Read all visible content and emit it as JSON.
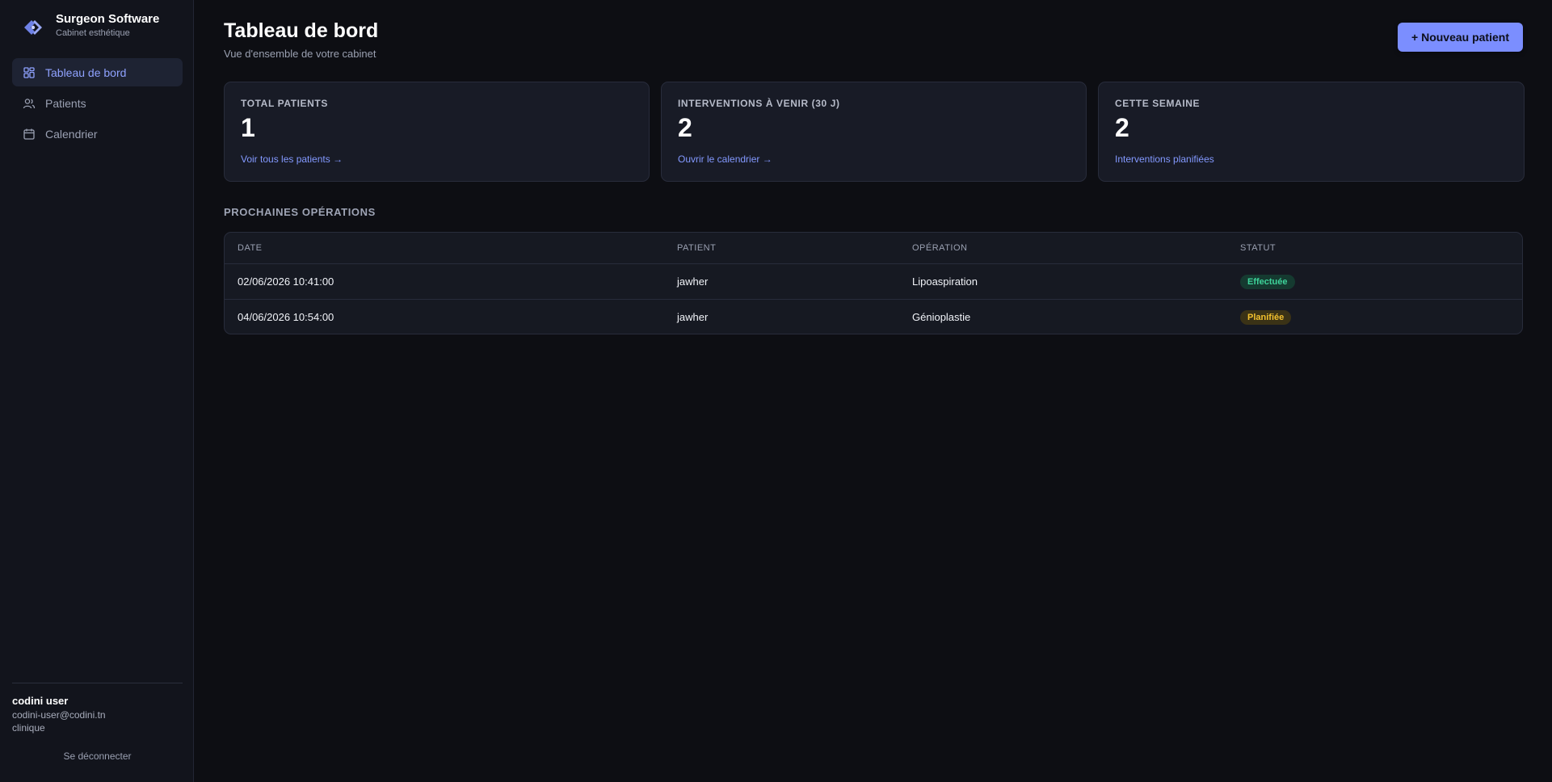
{
  "brand": {
    "name": "Surgeon Software",
    "subtitle": "Cabinet esthétique"
  },
  "sidebar": {
    "items": [
      {
        "label": "Tableau de bord",
        "icon": "dashboard-icon",
        "active": true
      },
      {
        "label": "Patients",
        "icon": "users-icon",
        "active": false
      },
      {
        "label": "Calendrier",
        "icon": "calendar-icon",
        "active": false
      }
    ]
  },
  "user": {
    "name": "codini user",
    "email": "codini-user@codini.tn",
    "role": "clinique",
    "logout_label": "Se déconnecter"
  },
  "header": {
    "title": "Tableau de bord",
    "subtitle": "Vue d'ensemble de votre cabinet",
    "new_patient_label": "+ Nouveau patient"
  },
  "stats": [
    {
      "label": "Total patients",
      "value": "1",
      "link": "Voir tous les patients →"
    },
    {
      "label": "Interventions à venir (30 j)",
      "value": "2",
      "link": "Ouvrir le calendrier →"
    },
    {
      "label": "Cette semaine",
      "value": "2",
      "link": "Interventions planifiées"
    }
  ],
  "operations": {
    "title": "Prochaines opérations",
    "columns": [
      "Date",
      "Patient",
      "Opération",
      "Statut"
    ],
    "rows": [
      {
        "date": "02/06/2026 10:41:00",
        "patient": "jawher",
        "operation": "Lipoaspiration",
        "status": "Effectuée"
      },
      {
        "date": "04/06/2026 10:54:00",
        "patient": "jawher",
        "operation": "Génioplastie",
        "status": "Planifiée"
      }
    ]
  },
  "colors": {
    "accent": "#7b8eff",
    "status_done": "#3ed39a",
    "status_planned": "#f2c02e"
  }
}
